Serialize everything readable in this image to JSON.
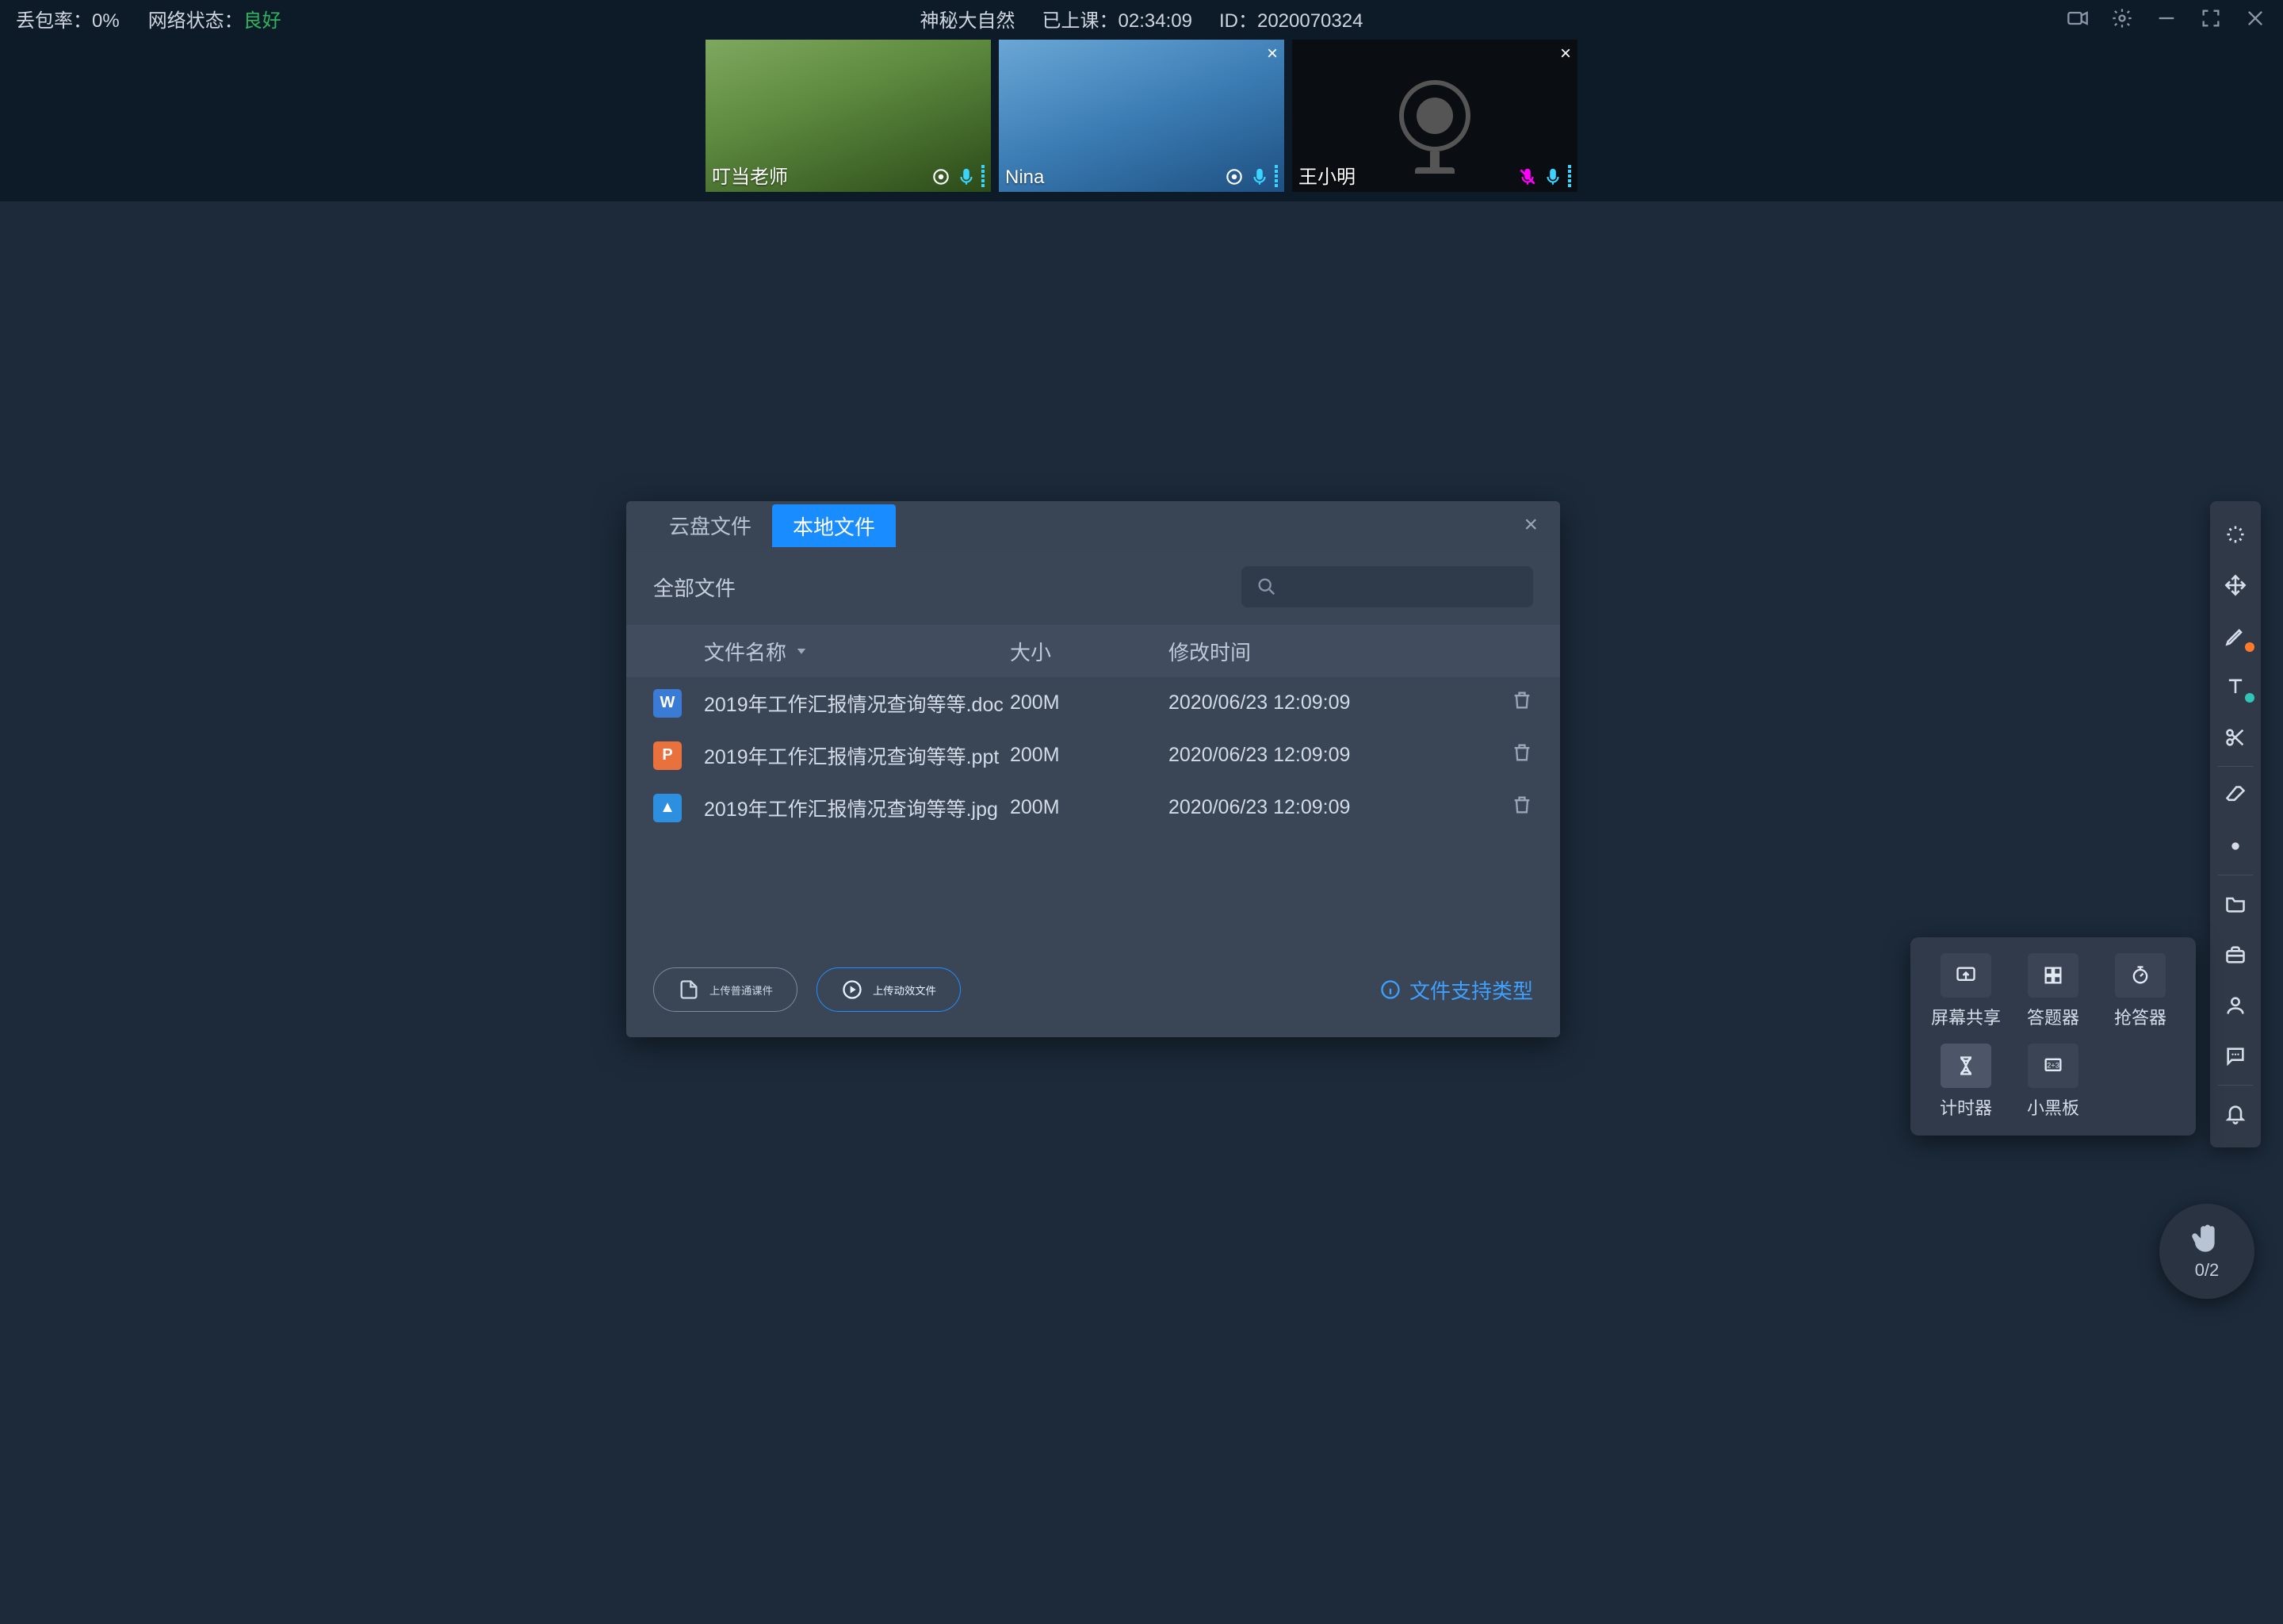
{
  "topbar": {
    "loss_label": "丢包率：0%",
    "net_label": "网络状态：",
    "net_status": "良好",
    "title": "神秘大自然",
    "elapsed_label": "已上课：",
    "elapsed_value": "02:34:09",
    "id_label": "ID：",
    "id_value": "2020070324"
  },
  "tiles": {
    "teacher": {
      "name": "叮当老师"
    },
    "nina": {
      "name": "Nina"
    },
    "wxm": {
      "name": "王小明"
    }
  },
  "dialog": {
    "tabs": {
      "cloud": "云盘文件",
      "local": "本地文件"
    },
    "all_files": "全部文件",
    "columns": {
      "name": "文件名称",
      "size": "大小",
      "mtime": "修改时间"
    },
    "rows": [
      {
        "icon": "w",
        "name": "2019年工作汇报情况查询等等.doc",
        "size": "200M",
        "mtime": "2020/06/23 12:09:09"
      },
      {
        "icon": "p",
        "name": "2019年工作汇报情况查询等等.ppt",
        "size": "200M",
        "mtime": "2020/06/23 12:09:09"
      },
      {
        "icon": "i",
        "name": "2019年工作汇报情况查询等等.jpg",
        "size": "200M",
        "mtime": "2020/06/23 12:09:09"
      }
    ],
    "btn_plain": "上传普通课件",
    "btn_effect": "上传动效文件",
    "support": "文件支持类型"
  },
  "tools_panel": {
    "screen_share": "屏幕共享",
    "answerer": "答题器",
    "buzzer": "抢答器",
    "timer": "计时器",
    "blackboard": "小黑板"
  },
  "fab": {
    "count": "0/2"
  },
  "icon_letters": {
    "w": "W",
    "p": "P",
    "i": "▲"
  }
}
